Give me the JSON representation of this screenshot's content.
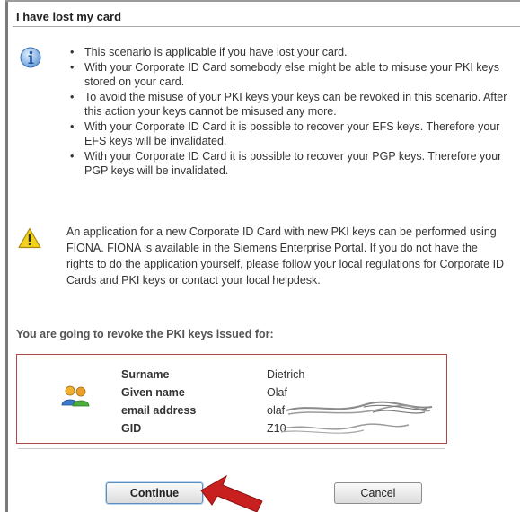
{
  "title": "I have lost my card",
  "info": {
    "icon": "info-icon",
    "bullets": [
      "This scenario is applicable if you have lost your card.",
      "With your Corporate ID Card somebody else might be able to misuse your PKI keys stored on your card.",
      "To avoid the misuse of your PKI keys your keys can be revoked in this scenario. After this action your keys cannot be misused any more.",
      "With your Corporate ID Card it is possible to recover your EFS keys. Therefore your EFS keys will be invalidated.",
      "With your Corporate ID Card it is possible to recover your PGP keys. Therefore your PGP keys will be invalidated."
    ]
  },
  "warning": {
    "icon": "warning-icon",
    "text": "An application for a new Corporate ID Card with new PKI keys can be performed using FIONA. FIONA is available in the Siemens Enterprise Portal. If you do not have the rights to do the application yourself, please follow your local regulations for Corporate ID Cards and PKI keys or contact your local helpdesk."
  },
  "revoke_heading": "You are going to revoke the PKI keys issued for:",
  "user": {
    "icon": "users-icon",
    "fields": [
      {
        "label": "Surname",
        "value": "Dietrich"
      },
      {
        "label": "Given name",
        "value": "Olaf"
      },
      {
        "label": "email address",
        "value": "olaf"
      },
      {
        "label": "GID",
        "value": "Z10"
      }
    ]
  },
  "buttons": {
    "continue": "Continue",
    "cancel": "Cancel"
  },
  "colors": {
    "box_border": "#b04848",
    "arrow": "#c8201e",
    "info_blue": "#2a6fc0",
    "warning_yellow": "#f2d21b"
  }
}
